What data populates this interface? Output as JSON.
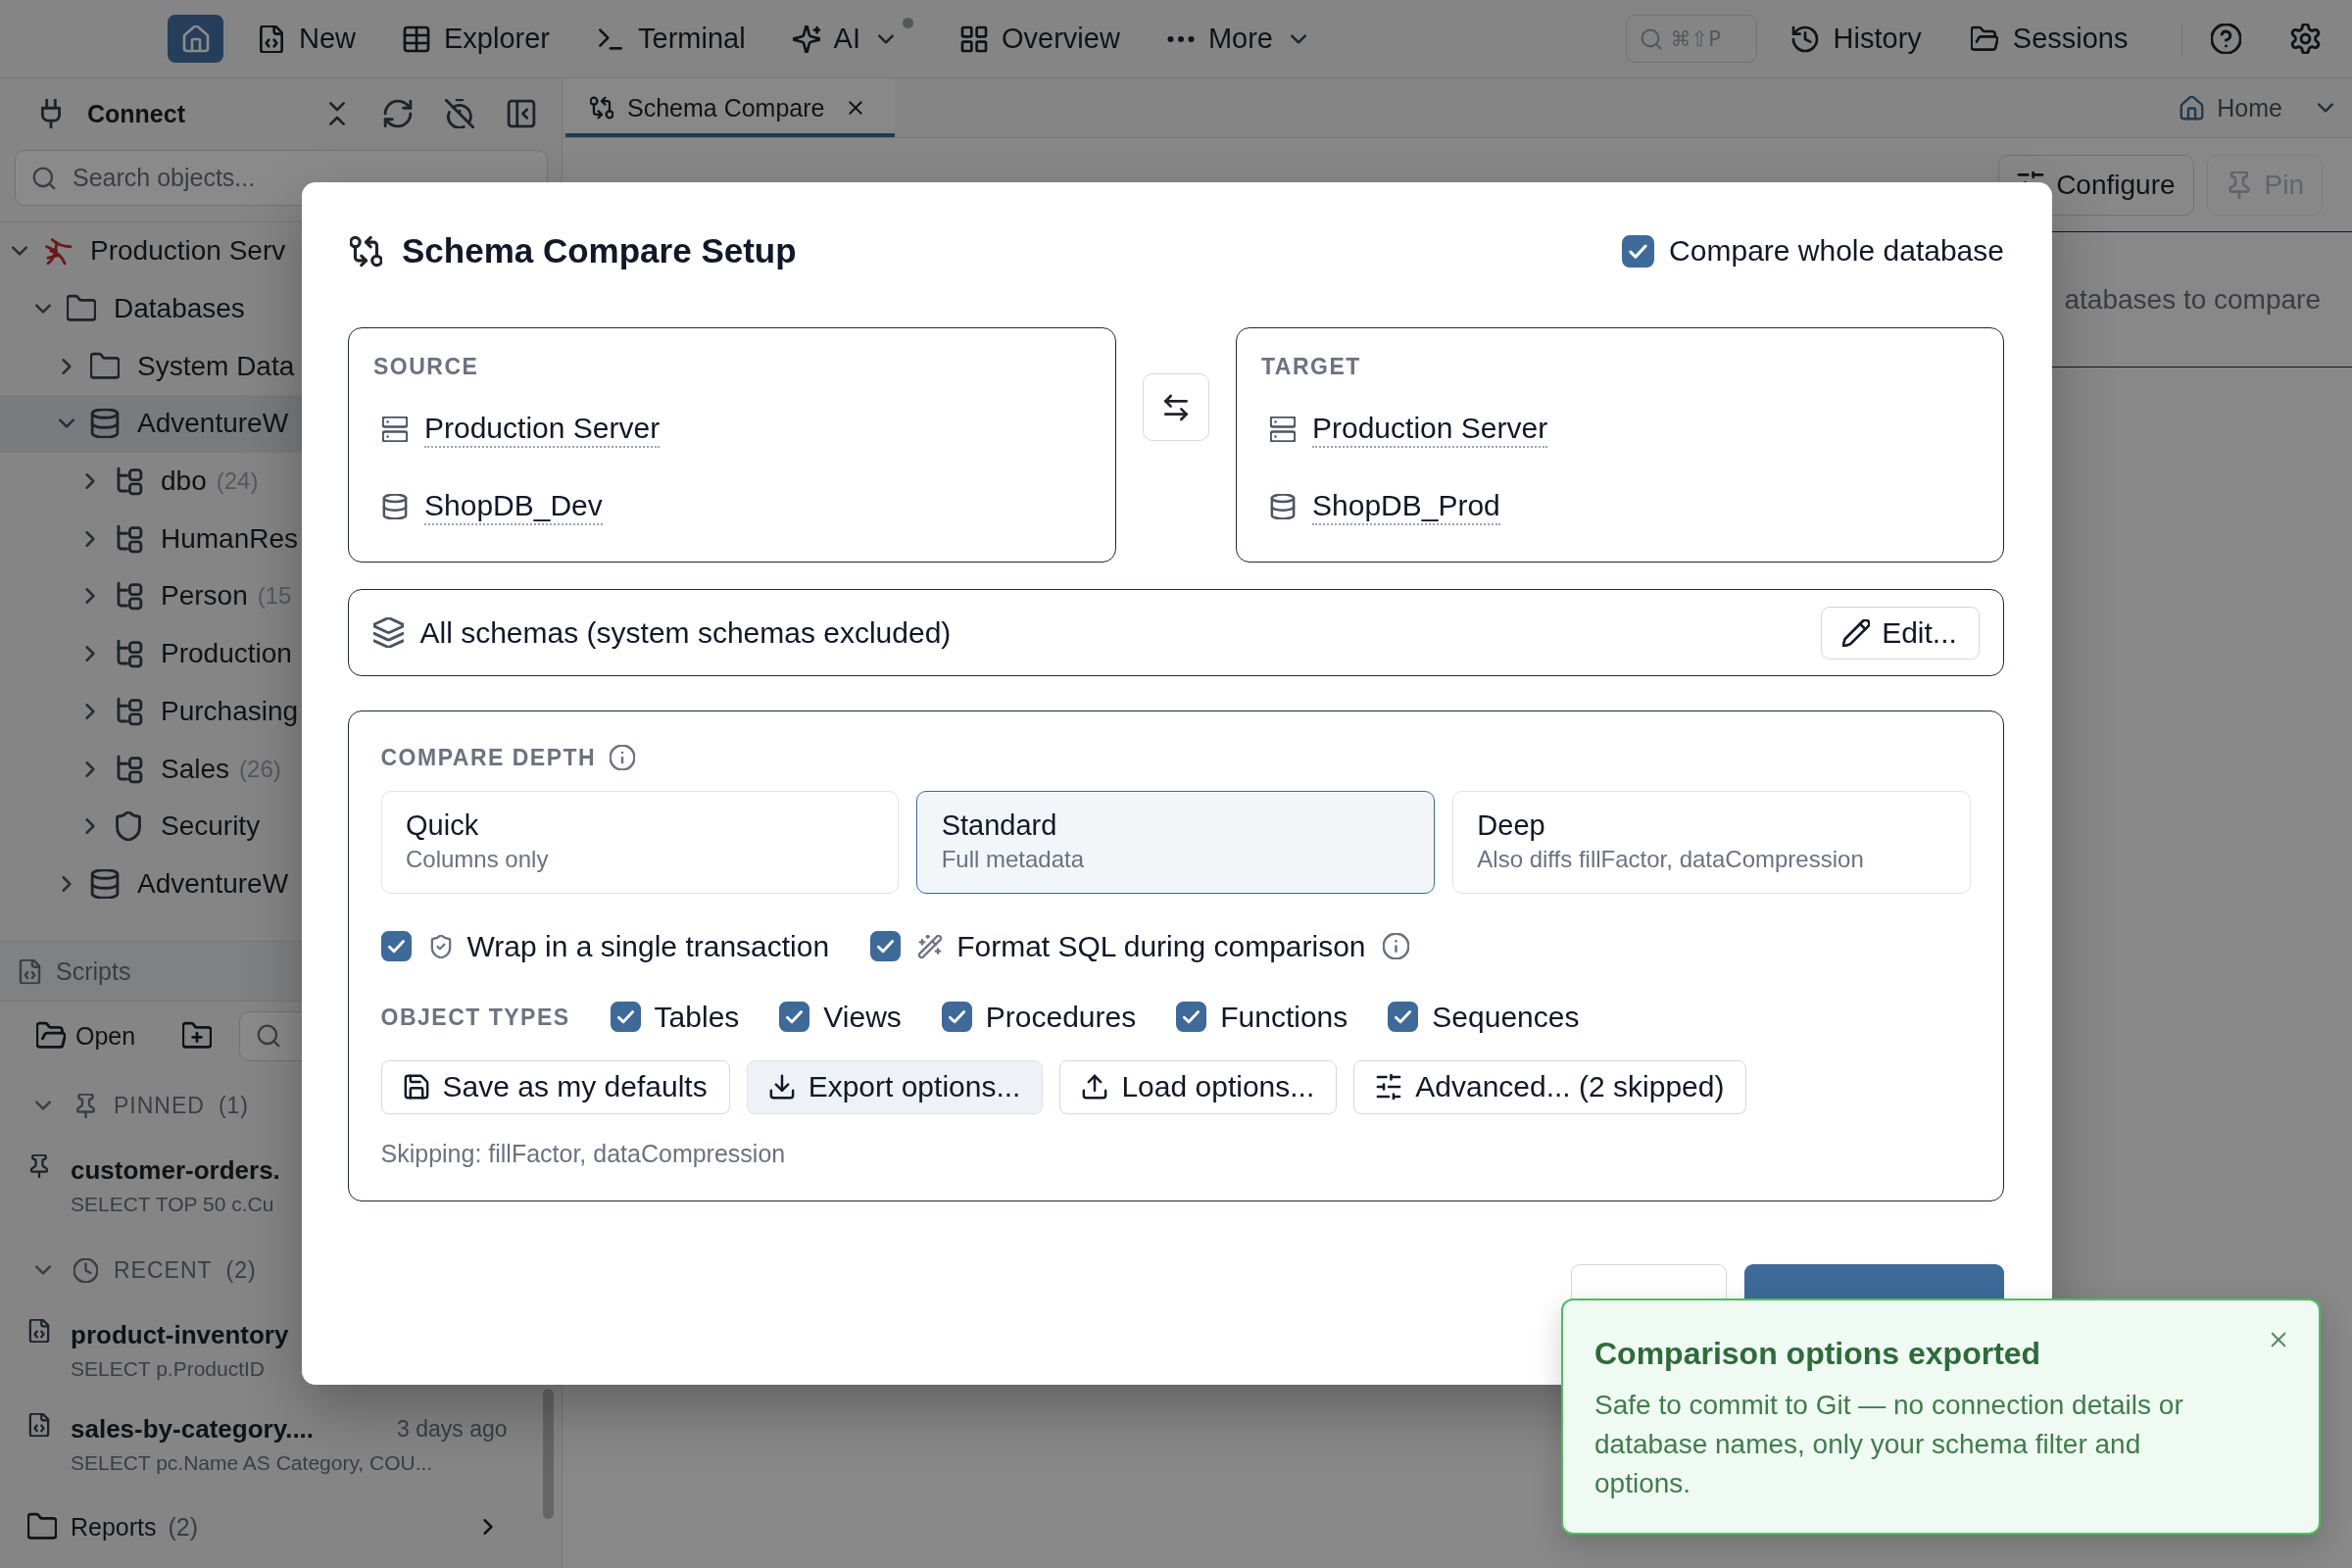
{
  "top_bar": {
    "nav": [
      {
        "kind": "icon",
        "selected": true
      },
      {
        "kind": "text",
        "label": "New",
        "selected": false,
        "dropdown": false,
        "notification": false
      },
      {
        "kind": "text",
        "label": "Explorer",
        "selected": false,
        "dropdown": false,
        "notification": false
      },
      {
        "kind": "text",
        "label": "Terminal",
        "selected": false,
        "dropdown": false,
        "notification": false
      },
      {
        "kind": "text",
        "label": "AI",
        "selected": false,
        "dropdown": true,
        "notification": true
      },
      {
        "kind": "text",
        "label": "Overview",
        "selected": false,
        "dropdown": false,
        "notification": false
      },
      {
        "kind": "text",
        "label": "More",
        "selected": false,
        "dropdown": true,
        "notification": false
      }
    ],
    "search": {
      "shortcut": "⌘⇧P"
    },
    "actions": [
      {
        "label": "History"
      },
      {
        "label": "Sessions"
      }
    ]
  },
  "sidebar": {
    "title": "Connect",
    "search": {
      "placeholder": "Search objects..."
    },
    "tree": [
      {
        "kind": "server",
        "label": "Production Serv",
        "expanded": true,
        "selected": false,
        "children": [
          {
            "kind": "folder",
            "label": "Databases",
            "expanded": true,
            "selected": false,
            "children": [
              {
                "kind": "folder",
                "label": "System Data",
                "expanded": false,
                "selected": false
              },
              {
                "kind": "database",
                "label": "AdventureW",
                "expanded": true,
                "selected": true,
                "children": [
                  {
                    "kind": "schema",
                    "label": "dbo",
                    "count": "(24)",
                    "expanded": false,
                    "selected": false
                  },
                  {
                    "kind": "schema",
                    "label": "HumanRes",
                    "expanded": false,
                    "selected": false
                  },
                  {
                    "kind": "schema",
                    "label": "Person",
                    "count": "(15",
                    "expanded": false,
                    "selected": false
                  },
                  {
                    "kind": "schema",
                    "label": "Production",
                    "expanded": false,
                    "selected": false
                  },
                  {
                    "kind": "schema",
                    "label": "Purchasing",
                    "expanded": false,
                    "selected": false
                  },
                  {
                    "kind": "schema",
                    "label": "Sales",
                    "count": "(26)",
                    "expanded": false,
                    "selected": false
                  },
                  {
                    "kind": "security",
                    "label": "Security",
                    "expanded": false,
                    "selected": false
                  }
                ]
              },
              {
                "kind": "database",
                "label": "AdventureW",
                "expanded": false,
                "selected": false
              }
            ]
          }
        ]
      }
    ]
  },
  "scripts": {
    "title": "Scripts",
    "open_label": "Open",
    "groups": [
      {
        "kind": "pinned",
        "label": "PINNED",
        "count": "(1)",
        "expanded": true,
        "items": [
          {
            "name": "customer-orders.",
            "preview": "SELECT TOP 50 c.Cu"
          }
        ]
      },
      {
        "kind": "recent",
        "label": "RECENT",
        "count": "(2)",
        "expanded": true,
        "items": [
          {
            "name": "product-inventory",
            "preview": "SELECT p.ProductID"
          },
          {
            "name": "sales-by-category....",
            "time": "3 days ago",
            "preview": "SELECT pc.Name AS Category, COU..."
          }
        ]
      }
    ],
    "folders": [
      {
        "label": "Reports",
        "count": "(2)",
        "expanded": false
      }
    ]
  },
  "tabs": [
    {
      "label": "Schema Compare",
      "selected": true
    }
  ],
  "home_menu": {
    "label": "Home"
  },
  "toolbar": {
    "buttons": [
      {
        "label": "Configure",
        "disabled": false
      },
      {
        "label": "Pin",
        "disabled": true
      }
    ]
  },
  "empty_state": "atabases to compare",
  "dialog": {
    "title": "Schema Compare Setup",
    "whole_database": {
      "label": "Compare whole database",
      "checked": true
    },
    "endpoints": [
      {
        "heading": "SOURCE",
        "server": "Production Server",
        "database": "ShopDB_Dev"
      },
      {
        "heading": "TARGET",
        "server": "Production Server",
        "database": "ShopDB_Prod"
      }
    ],
    "schema_filter": {
      "text": "All schemas (system schemas excluded)",
      "button": "Edit..."
    },
    "depth": {
      "heading": "COMPARE DEPTH",
      "options": [
        {
          "title": "Quick",
          "subtitle": "Columns only",
          "selected": false
        },
        {
          "title": "Standard",
          "subtitle": "Full metadata",
          "selected": true
        },
        {
          "title": "Deep",
          "subtitle": "Also diffs fillFactor, dataCompression",
          "selected": false
        }
      ]
    },
    "toggles": [
      {
        "label": "Wrap in a single transaction",
        "checked": true,
        "info": false
      },
      {
        "label": "Format SQL during comparison",
        "checked": true,
        "info": true
      }
    ],
    "object_types": {
      "heading": "OBJECT TYPES",
      "items": [
        {
          "label": "Tables",
          "checked": true
        },
        {
          "label": "Views",
          "checked": true
        },
        {
          "label": "Procedures",
          "checked": true
        },
        {
          "label": "Functions",
          "checked": true
        },
        {
          "label": "Sequences",
          "checked": true
        }
      ]
    },
    "actions": [
      {
        "label": "Save as my defaults",
        "pressed": false
      },
      {
        "label": "Export options...",
        "pressed": true
      },
      {
        "label": "Load options...",
        "pressed": false
      },
      {
        "label": "Advanced... (2 skipped)",
        "pressed": false
      }
    ],
    "note": "Skipping: fillFactor, dataCompression",
    "footer": [
      {
        "kind": "secondary"
      },
      {
        "kind": "primary"
      }
    ]
  },
  "toast": {
    "title": "Comparison options exported",
    "message": "Safe to commit to Git — no connection details or database names, only your schema filter and options."
  }
}
